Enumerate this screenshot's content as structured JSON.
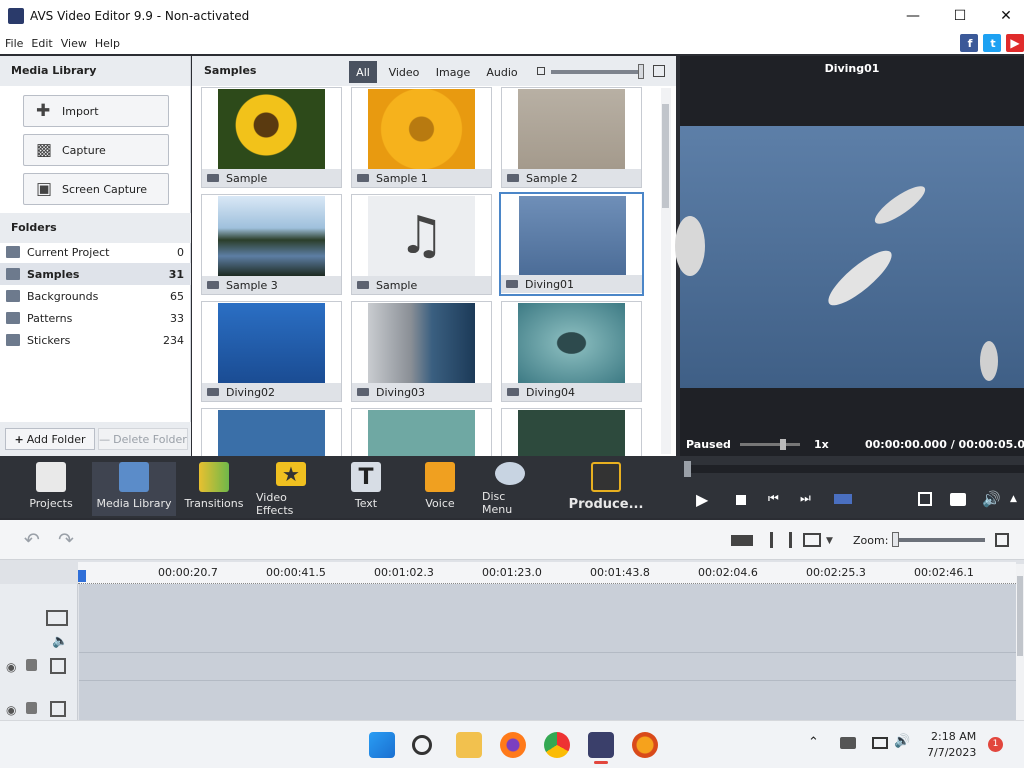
{
  "window": {
    "title": "AVS Video Editor 9.9 - Non-activated"
  },
  "menu": [
    "File",
    "Edit",
    "View",
    "Help"
  ],
  "social": {
    "fb": "f",
    "tw": "t"
  },
  "media_library": {
    "title": "Media Library",
    "buttons": {
      "import": "Import",
      "capture": "Capture",
      "screen_capture": "Screen Capture"
    },
    "folders_title": "Folders",
    "folders": [
      {
        "name": "Current Project",
        "count": "0"
      },
      {
        "name": "Samples",
        "count": "31"
      },
      {
        "name": "Backgrounds",
        "count": "65"
      },
      {
        "name": "Patterns",
        "count": "33"
      },
      {
        "name": "Stickers",
        "count": "234"
      }
    ],
    "add_folder": "Add Folder",
    "delete_folder": "Delete Folder"
  },
  "samples": {
    "title": "Samples",
    "filters": [
      "All",
      "Video",
      "Image",
      "Audio"
    ],
    "items": [
      {
        "label": "Sample"
      },
      {
        "label": "Sample 1"
      },
      {
        "label": "Sample 2"
      },
      {
        "label": "Sample 3"
      },
      {
        "label": "Sample"
      },
      {
        "label": "Diving01"
      },
      {
        "label": "Diving02"
      },
      {
        "label": "Diving03"
      },
      {
        "label": "Diving04"
      }
    ]
  },
  "preview": {
    "title": "Diving01",
    "status": "Paused",
    "speed": "1x",
    "time": "00:00:00.000 / 00:00:05.005"
  },
  "toolbar": {
    "projects": "Projects",
    "media_library": "Media Library",
    "transitions": "Transitions",
    "video_effects": "Video Effects",
    "text": "Text",
    "voice": "Voice",
    "disc_menu": "Disc Menu",
    "produce": "Produce..."
  },
  "timeline": {
    "zoom_label": "Zoom:",
    "ticks": [
      "00:00:20.7",
      "00:00:41.5",
      "00:01:02.3",
      "00:01:23.0",
      "00:01:43.8",
      "00:02:04.6",
      "00:02:25.3",
      "00:02:46.1"
    ]
  },
  "taskbar": {
    "time": "2:18 AM",
    "date": "7/7/2023",
    "badge": "1"
  },
  "colors": {
    "accent": "#4b86c8",
    "dark_panel": "#2f3238",
    "selected_filter": "#4a5260"
  }
}
